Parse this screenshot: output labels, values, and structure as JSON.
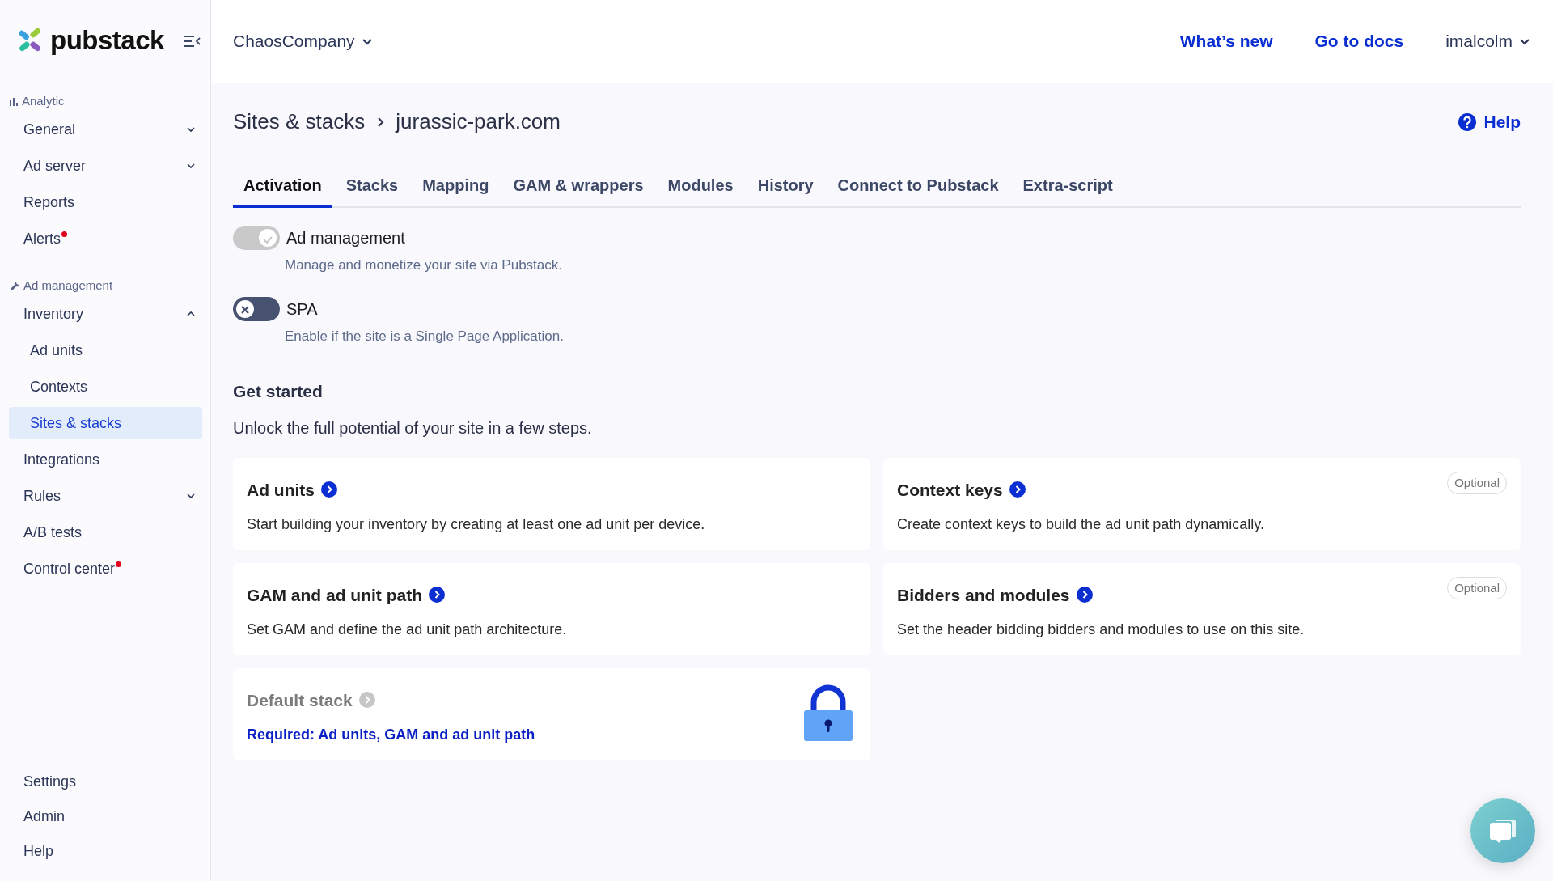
{
  "sidebar": {
    "logo": "pubstack",
    "sections": [
      {
        "title": "Analytic",
        "items": [
          {
            "label": "General",
            "expanded": false,
            "selected": false
          },
          {
            "label": "Ad server",
            "expanded": false,
            "selected": false
          },
          {
            "label": "Reports",
            "selected": false
          },
          {
            "label": "Alerts",
            "alert": true,
            "selected": false
          }
        ]
      },
      {
        "title": "Ad management",
        "items": [
          {
            "label": "Inventory",
            "expanded": true,
            "selected": false,
            "children": [
              {
                "label": "Ad units",
                "selected": false
              },
              {
                "label": "Contexts",
                "selected": false
              },
              {
                "label": "Sites & stacks",
                "selected": true
              }
            ]
          },
          {
            "label": "Integrations",
            "selected": false
          },
          {
            "label": "Rules",
            "expanded": false,
            "selected": false
          },
          {
            "label": "A/B tests",
            "selected": false
          },
          {
            "label": "Control center",
            "alert": true,
            "selected": false
          }
        ]
      }
    ],
    "bottom_items": [
      {
        "label": "Settings",
        "selected": false
      },
      {
        "label": "Admin",
        "selected": false
      },
      {
        "label": "Help",
        "selected": false
      }
    ]
  },
  "header": {
    "organization": "ChaosCompany",
    "links": [
      "What’s new",
      "Go to docs"
    ],
    "user": "imalcolm"
  },
  "breadcrumb": [
    "Sites & stacks",
    "jurassic-park.com"
  ],
  "help": "Help",
  "tabs": [
    {
      "label": "Activation",
      "selected": true
    },
    {
      "label": "Stacks",
      "selected": false
    },
    {
      "label": "Mapping",
      "selected": false
    },
    {
      "label": "GAM & wrappers",
      "selected": false
    },
    {
      "label": "Modules",
      "selected": false
    },
    {
      "label": "History",
      "selected": false
    },
    {
      "label": "Connect to Pubstack",
      "selected": false
    },
    {
      "label": "Extra-script",
      "selected": false
    }
  ],
  "toggles": [
    {
      "label": "Ad management",
      "description": "Manage and monetize your site via Pubstack.",
      "on": true,
      "disabled": true
    },
    {
      "label": "SPA",
      "description": "Enable if the site is a Single Page Application.",
      "on": false,
      "disabled": false
    }
  ],
  "get_started": {
    "title": "Get started",
    "subtitle": "Unlock the full potential of your site in a few steps.",
    "cards": [
      {
        "kind": "step",
        "title": "Ad units",
        "description": "Start building your inventory by creating at least one ad unit per device."
      },
      {
        "kind": "step",
        "title": "Context keys",
        "description": "Create context keys to build the ad unit path dynamically.",
        "badge": "Optional"
      },
      {
        "kind": "step",
        "title": "GAM and ad unit path",
        "description": "Set GAM and define the ad unit path architecture."
      },
      {
        "kind": "step",
        "title": "Bidders and modules",
        "description": "Set the header bidding bidders and modules to use on this site.",
        "badge": "Optional"
      },
      {
        "kind": "locked",
        "title": "Default stack",
        "requirement": "Required: Ad units, GAM and ad unit path"
      }
    ]
  }
}
